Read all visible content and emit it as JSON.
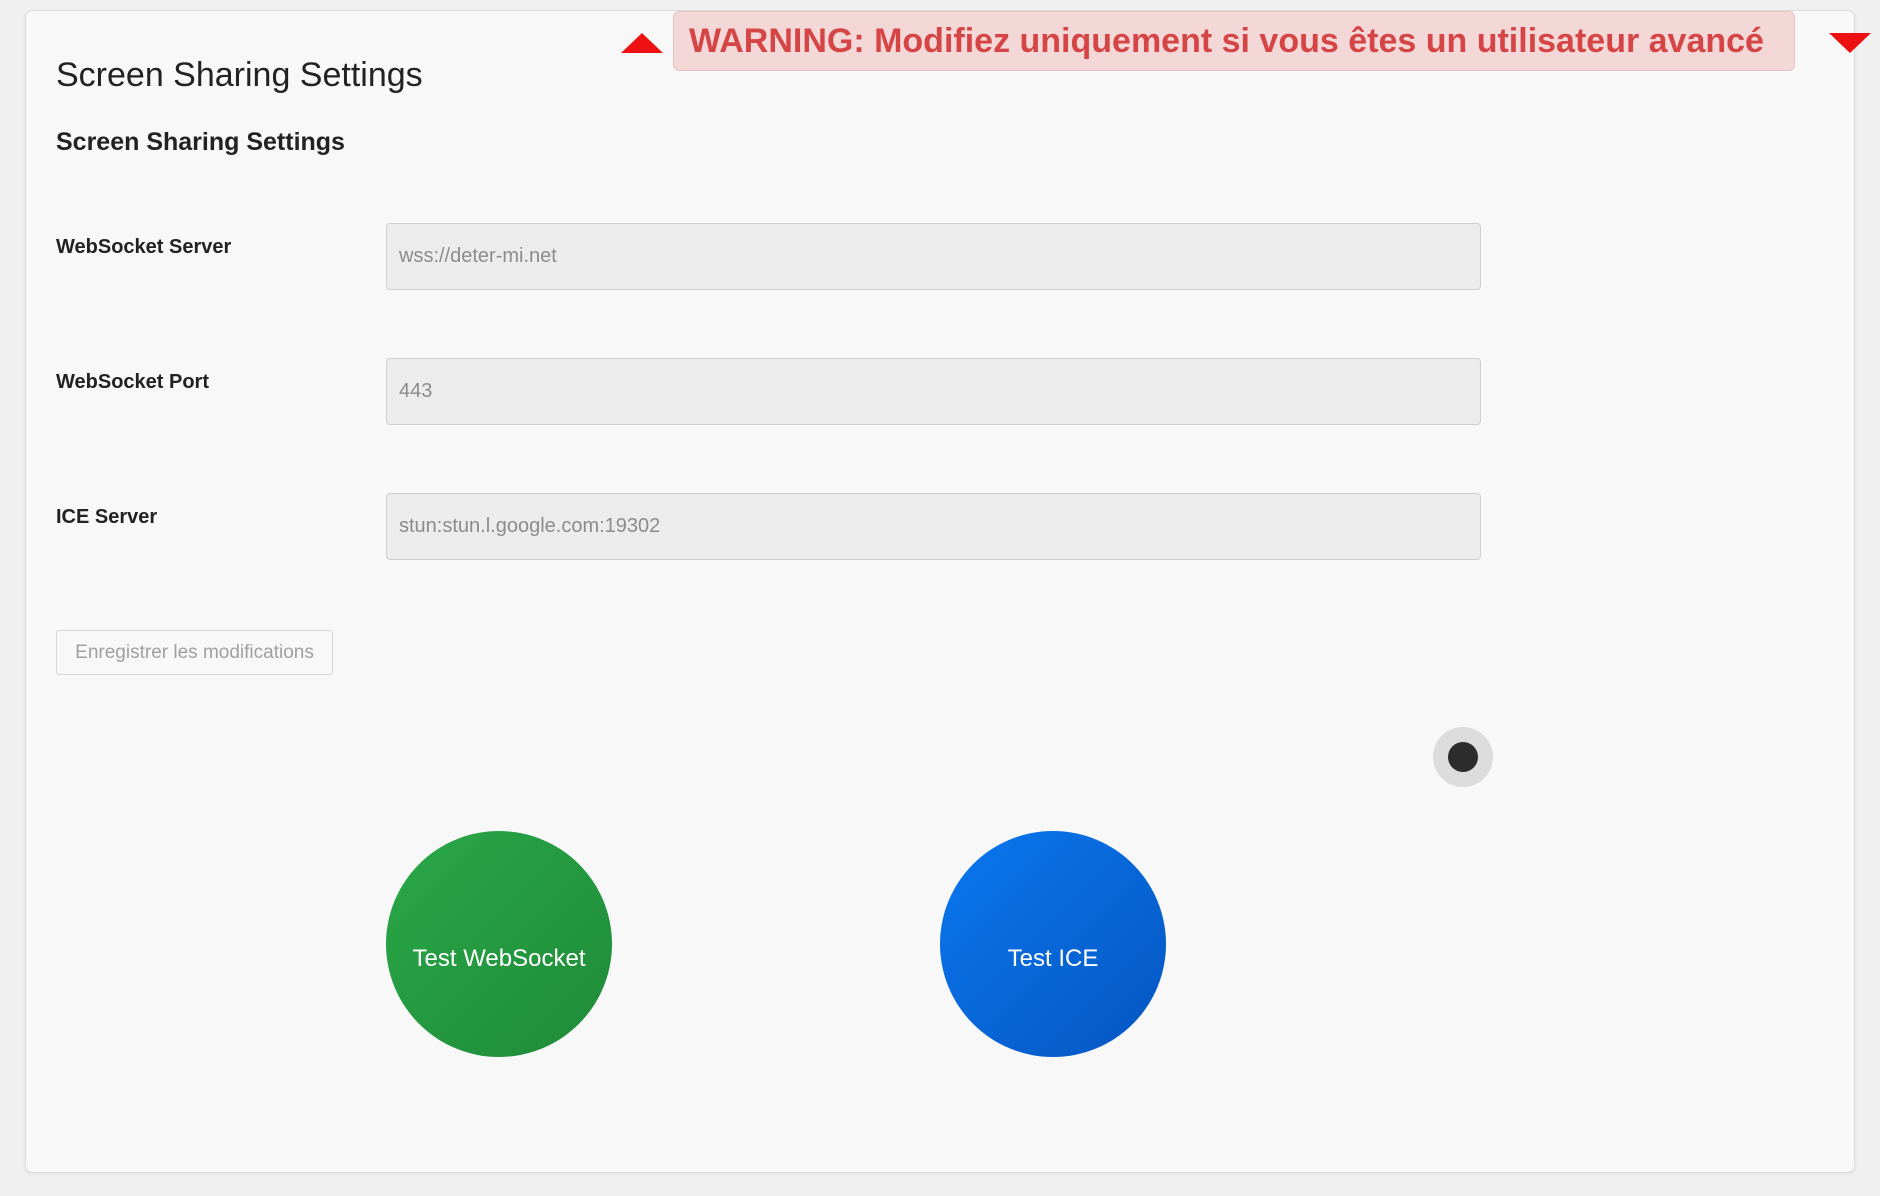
{
  "page": {
    "title": "Screen Sharing Settings",
    "section_title": "Screen Sharing Settings"
  },
  "warning": {
    "text": "WARNING: Modifiez uniquement si vous êtes un utilisateur avancé",
    "color": "#d64545",
    "background": "#f4d8d8",
    "arrow_color": "#ee1111",
    "arrow_up_icon": "triangle-up-icon",
    "arrow_down_icon": "triangle-down-icon"
  },
  "fields": [
    {
      "label": "WebSocket Server",
      "value": "",
      "placeholder": "wss://deter-mi.net"
    },
    {
      "label": "WebSocket Port",
      "value": "",
      "placeholder": "443"
    },
    {
      "label": "ICE Server",
      "value": "",
      "placeholder": "stun:stun.l.google.com:19302"
    }
  ],
  "actions": {
    "save_label": "Enregistrer les modifications",
    "test_websocket_label": "Test WebSocket",
    "test_ice_label": "Test ICE",
    "test_websocket_color": "#28a745",
    "test_ice_color": "#007bff"
  },
  "toggle": {
    "icon": "toggle-knob-icon"
  }
}
